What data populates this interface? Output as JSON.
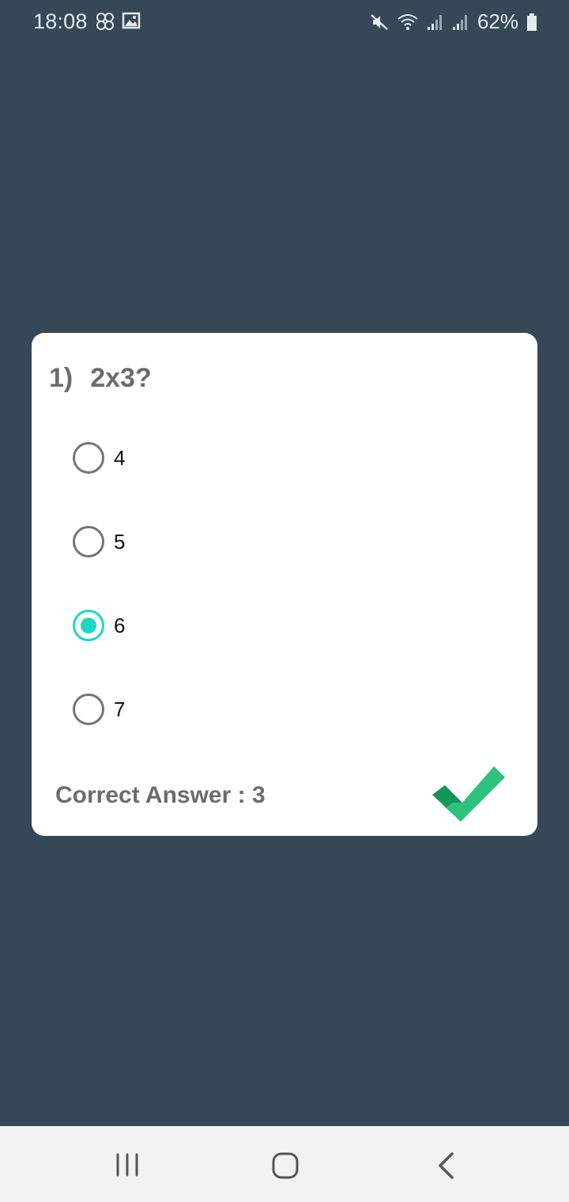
{
  "status_bar": {
    "time": "18:08",
    "battery_percent": "62%",
    "icons": [
      "flower-icon",
      "gallery-icon",
      "mute-icon",
      "wifi-icon",
      "signal-icon",
      "signal-icon",
      "battery-icon"
    ]
  },
  "question": {
    "number": "1)",
    "text": "2x3?"
  },
  "options": [
    {
      "label": "4",
      "selected": false
    },
    {
      "label": "5",
      "selected": false
    },
    {
      "label": "6",
      "selected": true
    },
    {
      "label": "7",
      "selected": false
    }
  ],
  "result": {
    "correct_answer_text": "Correct Answer : 3",
    "icon": "checkmark-icon",
    "color": "#2ebf7a"
  },
  "nav_bar": {
    "buttons": [
      "recent-apps-icon",
      "home-icon",
      "back-icon"
    ]
  },
  "colors": {
    "background": "#364856",
    "accent": "#1ed6c1"
  }
}
